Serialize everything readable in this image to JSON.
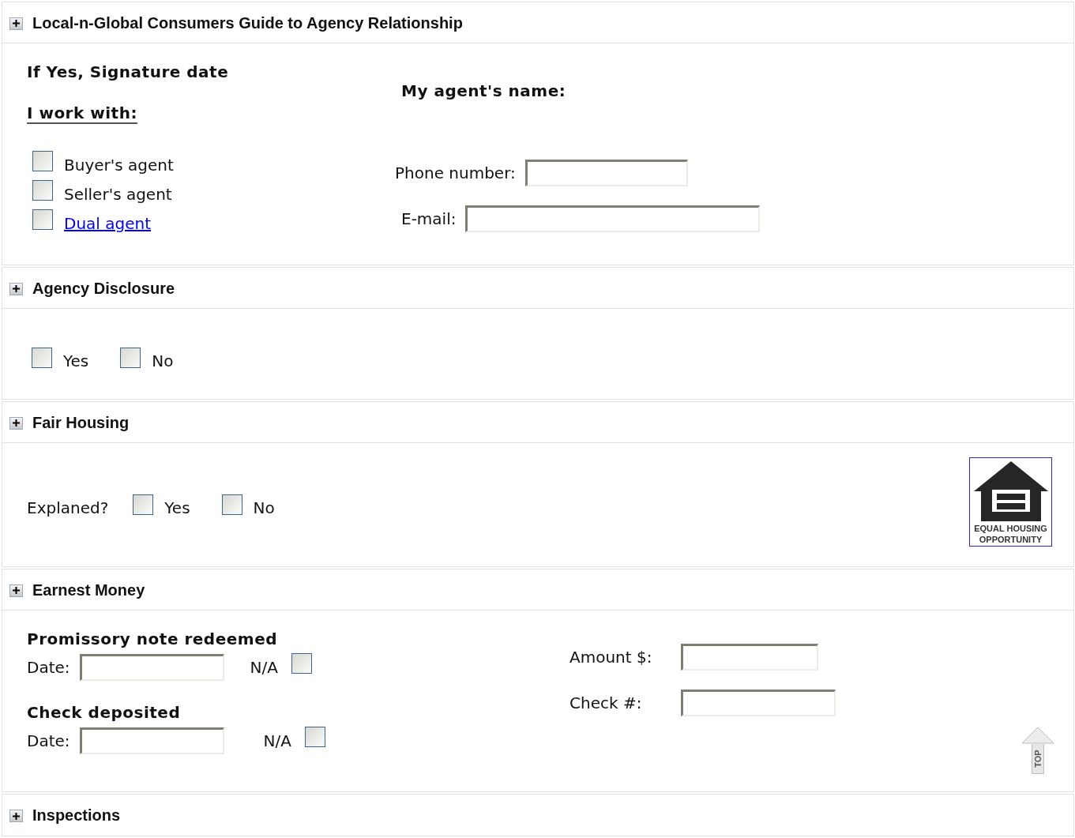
{
  "sections": [
    {
      "kind": "agency",
      "title": "Local-n-Global Consumers Guide to Agency Relationship",
      "signature_label": "If Yes, Signature date",
      "work_with_label": "I work with:",
      "options": [
        {
          "label": "Buyer's agent",
          "checked": false,
          "kind": "text"
        },
        {
          "label": "Seller's agent",
          "checked": false,
          "kind": "text"
        },
        {
          "label": "Dual agent",
          "checked": false,
          "kind": "link"
        }
      ],
      "agent_name_label": "My agent's name:",
      "fields": [
        {
          "label": "Phone number:"
        },
        {
          "label": "E-mail:"
        }
      ]
    },
    {
      "kind": "disclosure",
      "title": "Agency Disclosure",
      "options": [
        {
          "label": "Yes",
          "checked": false
        },
        {
          "label": "No",
          "checked": false
        }
      ]
    },
    {
      "kind": "fair_housing",
      "title": "Fair Housing",
      "question": "Explaned?",
      "options": [
        {
          "label": "Yes",
          "checked": false
        },
        {
          "label": "No",
          "checked": false
        }
      ],
      "logo_lines": [
        "EQUAL HOUSING",
        "OPPORTUNITY"
      ]
    },
    {
      "kind": "earnest",
      "title": "Earnest Money",
      "groups": [
        {
          "heading": "Promissory note redeemed",
          "date_label": "Date:",
          "na_label": "N/A",
          "na_checked": false
        },
        {
          "heading": "Check deposited",
          "date_label": "Date:",
          "na_label": "N/A",
          "na_checked": false
        }
      ],
      "fields": [
        {
          "label": "Amount $:"
        },
        {
          "label": "Check #:"
        }
      ],
      "top_link": "TOP"
    },
    {
      "kind": "header_only",
      "title": "Inspections"
    }
  ]
}
